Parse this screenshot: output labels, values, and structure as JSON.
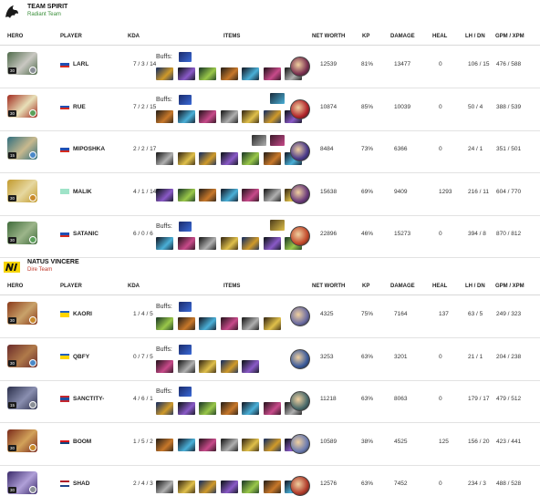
{
  "columns": {
    "hero": "HERO",
    "player": "PLAYER",
    "kda": "KDA",
    "items": "ITEMS",
    "networth": "NET WORTH",
    "kp": "KP",
    "damage": "DAMAGE",
    "heal": "HEAL",
    "lhdn": "LH / DN",
    "gpmxpm": "GPM / XPM"
  },
  "buffs_label": "Buffs:",
  "teams": [
    {
      "name": "TEAM SPIRIT",
      "side": "Radiant Team",
      "side_color": "#3a8f3a",
      "players": [
        {
          "player": "LARL",
          "flag": [
            "#ffffff",
            "#1f4fb4",
            "#d52b1e"
          ],
          "level": "30",
          "kda": "7 / 3 / 14",
          "networth": "12539",
          "kp": "81%",
          "damage": "13477",
          "heal": "0",
          "lhdn": "106 / 15",
          "gpmxpm": "476 / 588",
          "hero_colors": [
            "#4f6a4a",
            "#c9c8c2"
          ],
          "facet": "#8a8f96",
          "buffs": 1,
          "top_items": 0,
          "items": 7,
          "neutral": "#7a3050"
        },
        {
          "player": "RUE",
          "flag": [
            "#ffffff",
            "#1f4fb4",
            "#d52b1e"
          ],
          "level": "30",
          "kda": "7 / 2 / 15",
          "networth": "10874",
          "kp": "85%",
          "damage": "10039",
          "heal": "0",
          "lhdn": "50 / 4",
          "gpmxpm": "388 / 539",
          "hero_colors": [
            "#a22b1f",
            "#e8e0b8"
          ],
          "facet": "#5aa05a",
          "buffs": 1,
          "top_items": 1,
          "items": 7,
          "neutral": "#b0242a"
        },
        {
          "player": "MIPOSHKA",
          "flag": [
            "#ffffff",
            "#1f4fb4",
            "#d52b1e"
          ],
          "level": "15",
          "kda": "2 / 2 / 17",
          "networth": "8484",
          "kp": "73%",
          "damage": "6366",
          "heal": "0",
          "lhdn": "24 / 1",
          "gpmxpm": "351 / 501",
          "hero_colors": [
            "#2f6e7e",
            "#c8b98e"
          ],
          "facet": "#4a88c8",
          "buffs": 0,
          "top_items": 2,
          "items": 7,
          "neutral": "#4a3a8a"
        },
        {
          "player": "MALIK",
          "flag": [
            "#9fe3c8",
            "#9fe3c8",
            "#9fe3c8"
          ],
          "level": "30",
          "kda": "4 / 1 / 14",
          "networth": "15638",
          "kp": "69%",
          "damage": "9409",
          "heal": "1293",
          "lhdn": "216 / 11",
          "gpmxpm": "604 / 770",
          "hero_colors": [
            "#c29a2e",
            "#e6d8a0"
          ],
          "facet": "#c98a2a",
          "buffs": 0,
          "top_items": 0,
          "items": 7,
          "neutral": "#6a3a7a"
        },
        {
          "player": "SATANIC",
          "flag": [
            "#ffffff",
            "#1f4fb4",
            "#d52b1e"
          ],
          "level": "30",
          "kda": "6 / 0 / 6",
          "networth": "22896",
          "kp": "46%",
          "damage": "15273",
          "heal": "0",
          "lhdn": "394 / 8",
          "gpmxpm": "870 / 812",
          "hero_colors": [
            "#3f6b3a",
            "#9cb58a"
          ],
          "facet": "#5aa05a",
          "buffs": 1,
          "top_items": 1,
          "items": 7,
          "neutral": "#c2482a"
        }
      ]
    },
    {
      "name": "NATUS VINCERE",
      "side": "Dire Team",
      "side_color": "#c0392b",
      "players": [
        {
          "player": "KAORI",
          "flag": [
            "#1f5fbf",
            "#ffd500",
            "#ffd500"
          ],
          "level": "30",
          "kda": "1 / 4 / 5",
          "networth": "4325",
          "kp": "75%",
          "damage": "7164",
          "heal": "137",
          "lhdn": "63 / 5",
          "gpmxpm": "249 / 323",
          "hero_colors": [
            "#8a3a1a",
            "#c9a26a"
          ],
          "facet": "#c98a2a",
          "buffs": 1,
          "top_items": 0,
          "items": 6,
          "neutral": "#6a6aa0"
        },
        {
          "player": "QBFY",
          "flag": [
            "#1f5fbf",
            "#ffd500",
            "#ffd500"
          ],
          "level": "30",
          "kda": "0 / 7 / 5",
          "networth": "3253",
          "kp": "63%",
          "damage": "3201",
          "heal": "0",
          "lhdn": "21 / 1",
          "gpmxpm": "204 / 238",
          "hero_colors": [
            "#6a2a2a",
            "#b07a4a"
          ],
          "facet": "#4a88c8",
          "buffs": 1,
          "top_items": 0,
          "items": 5,
          "neutral": "#3a5a9a"
        },
        {
          "player": "SANCTITY-",
          "flag": [
            "#c4272f",
            "#1f4fa0",
            "#c4272f"
          ],
          "level": "15",
          "kda": "4 / 6 / 1",
          "networth": "11218",
          "kp": "63%",
          "damage": "8063",
          "heal": "0",
          "lhdn": "179 / 17",
          "gpmxpm": "479 / 512",
          "hero_colors": [
            "#2a2e4a",
            "#8a8fb0"
          ],
          "facet": "#8a8f96",
          "buffs": 1,
          "top_items": 0,
          "items": 7,
          "neutral": "#4a6a6a"
        },
        {
          "player": "BOOM",
          "flag": [
            "#ffffff",
            "#d7141a",
            "#11457e"
          ],
          "level": "30",
          "kda": "1 / 5 / 2",
          "networth": "10589",
          "kp": "38%",
          "damage": "4525",
          "heal": "125",
          "lhdn": "156 / 20",
          "gpmxpm": "423 / 441",
          "hero_colors": [
            "#7a2a1a",
            "#d2a25a"
          ],
          "facet": "#c98a2a",
          "buffs": 0,
          "top_items": 0,
          "items": 7,
          "neutral": "#6a7ab0"
        },
        {
          "player": "SHAD",
          "flag": [
            "#ae1c28",
            "#ffffff",
            "#21468b"
          ],
          "level": "30",
          "kda": "2 / 4 / 3",
          "networth": "12576",
          "kp": "63%",
          "damage": "7452",
          "heal": "0",
          "lhdn": "234 / 3",
          "gpmxpm": "488 / 528",
          "hero_colors": [
            "#3a2a6a",
            "#b0a0d8"
          ],
          "facet": "#8a8f96",
          "buffs": 0,
          "top_items": 0,
          "items": 7,
          "neutral": "#b03a2a"
        }
      ]
    }
  ]
}
